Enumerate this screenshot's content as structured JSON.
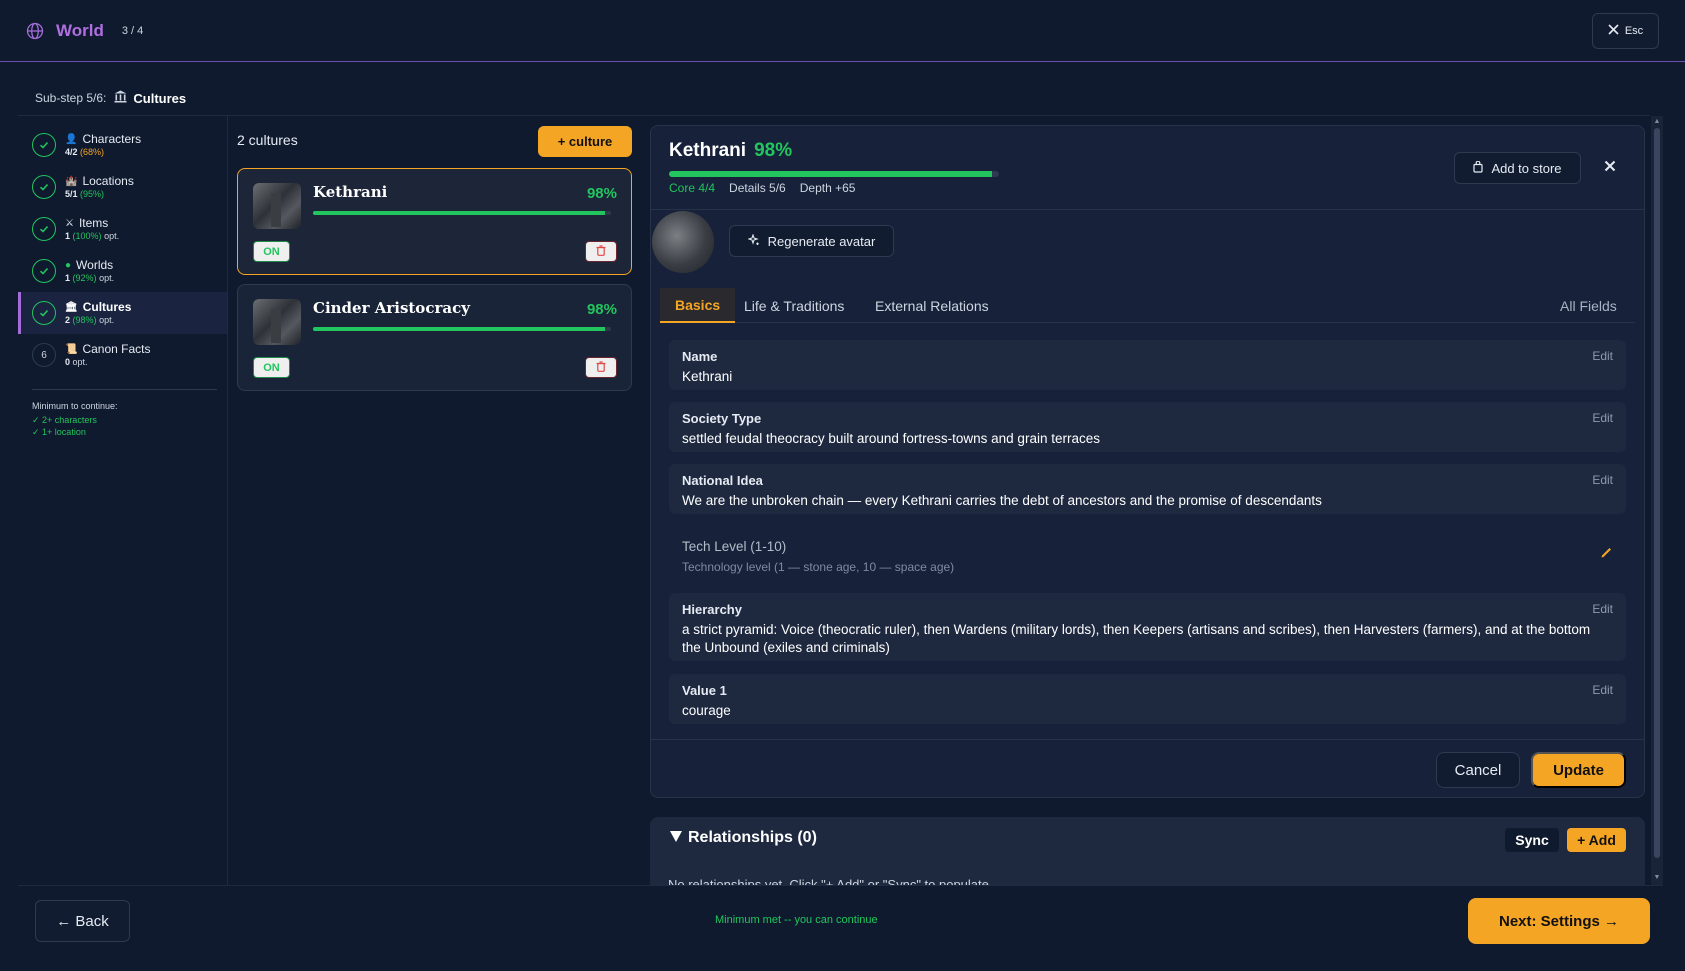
{
  "header": {
    "title": "World",
    "step_count": "3 / 4",
    "close_label": "Esc"
  },
  "substep": {
    "label": "Sub-step 5/6:",
    "title": "Cultures"
  },
  "steps": [
    {
      "name": "Characters",
      "count": "4/2",
      "pct": "(68%)",
      "opt": "",
      "state": "done"
    },
    {
      "name": "Locations",
      "count": "5/1",
      "pct": "(95%)",
      "opt": "",
      "state": "done"
    },
    {
      "name": "Items",
      "count": "1",
      "pct": "(100%)",
      "opt": "opt.",
      "state": "done"
    },
    {
      "name": "Worlds",
      "count": "1",
      "pct": "(92%)",
      "opt": "opt.",
      "state": "done"
    },
    {
      "name": "Cultures",
      "count": "2",
      "pct": "(98%)",
      "opt": "opt.",
      "state": "active"
    },
    {
      "name": "Canon Facts",
      "count": "0",
      "pct": "",
      "opt": "opt.",
      "state": "todo",
      "number": "6"
    }
  ],
  "minimum": {
    "title": "Minimum to continue:",
    "items": [
      "✓ 2+ characters",
      "✓ 1+ location"
    ]
  },
  "list": {
    "count_label": "2 cultures",
    "add_label": "+ culture",
    "cultures": [
      {
        "name": "Kethrani",
        "pct": "98%",
        "progress": 98,
        "status": "ON"
      },
      {
        "name": "Cinder Aristocracy",
        "pct": "98%",
        "progress": 98,
        "status": "ON"
      }
    ]
  },
  "detail": {
    "name": "Kethrani",
    "pct": "98%",
    "progress": 98,
    "stats": {
      "core": "Core 4/4",
      "details": "Details 5/6",
      "depth": "Depth +65"
    },
    "store_label": "Add to store",
    "regen_label": "Regenerate avatar",
    "tabs": [
      "Basics",
      "Life & Traditions",
      "External Relations"
    ],
    "all_fields": "All Fields",
    "edit_label": "Edit",
    "fields": [
      {
        "label": "Name",
        "value": "Kethrani"
      },
      {
        "label": "Society Type",
        "value": "settled feudal theocracy built around fortress-towns and grain terraces"
      },
      {
        "label": "National Idea",
        "value": "We are the unbroken chain — every Kethrani carries the debt of ancestors and the promise of descendants"
      },
      {
        "label": "Tech Level (1-10)",
        "value": "Technology level (1 — stone age, 10 — space age)"
      },
      {
        "label": "Hierarchy",
        "value": "a strict pyramid: Voice (theocratic ruler), then Wardens (military lords), then Keepers (artisans and scribes), then Harvesters (farmers), and at the bottom the Unbound (exiles and criminals)"
      },
      {
        "label": "Value 1",
        "value": "courage"
      }
    ],
    "cancel_label": "Cancel",
    "update_label": "Update"
  },
  "relationships": {
    "title": "Relationships (0)",
    "sync_label": "Sync",
    "add_label": "+ Add",
    "empty": "No relationships yet. Click \"+ Add\" or \"Sync\" to populate."
  },
  "footer": {
    "back_label": "← Back",
    "message": "Minimum met -- you can continue",
    "next_label": "Next: Settings →"
  },
  "colors": {
    "accent": "#f5a524",
    "success": "#22c55e",
    "brand": "#b06fe0",
    "background": "#0f1a2e"
  }
}
